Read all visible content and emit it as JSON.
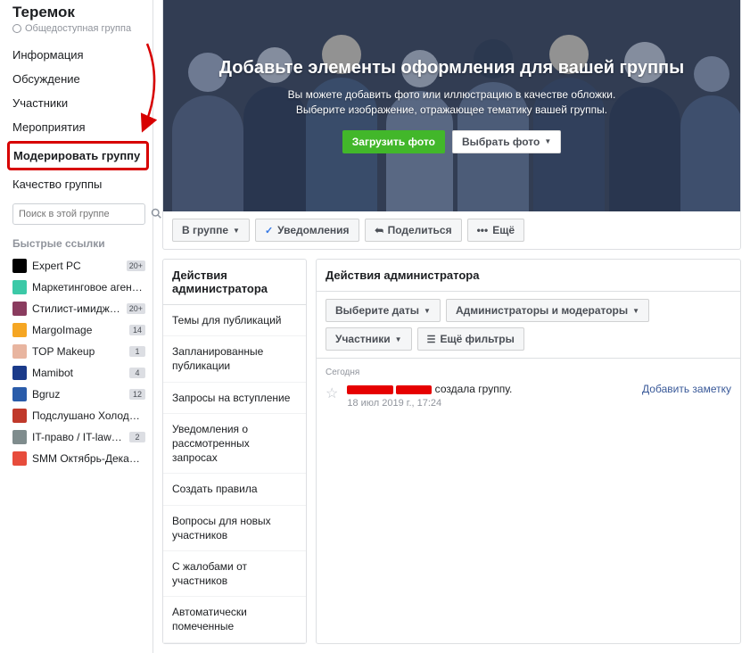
{
  "sidebar": {
    "group_name": "Теремок",
    "group_visibility": "Общедоступная группа",
    "nav": [
      {
        "label": "Информация"
      },
      {
        "label": "Обсуждение"
      },
      {
        "label": "Участники"
      },
      {
        "label": "Мероприятия"
      },
      {
        "label": "Модерировать группу",
        "highlighted": true
      },
      {
        "label": "Качество группы"
      }
    ],
    "search_placeholder": "Поиск в этой группе",
    "quick_links_title": "Быстрые ссылки",
    "quick_links": [
      {
        "label": "Expert PC",
        "badge": "20+",
        "color": "#000000"
      },
      {
        "label": "Маркетинговое агентс...",
        "badge": "",
        "color": "#3cc9a7"
      },
      {
        "label": "Стилист-имиджме...",
        "badge": "20+",
        "color": "#8a3c5f"
      },
      {
        "label": "MargoImage",
        "badge": "14",
        "color": "#f5a623"
      },
      {
        "label": "TOP Makeup",
        "badge": "1",
        "color": "#e8b5a0"
      },
      {
        "label": "Mamibot",
        "badge": "4",
        "color": "#1a3a8a"
      },
      {
        "label": "Bgruz",
        "badge": "12",
        "color": "#2a5caa"
      },
      {
        "label": "Подслушано Холодна...",
        "badge": "",
        "color": "#c0392b"
      },
      {
        "label": "IT-право / IT-law и д...",
        "badge": "2",
        "color": "#7f8c8d"
      },
      {
        "label": "SMM Октябрь-Декабрь",
        "badge": "",
        "color": "#e74c3c"
      }
    ]
  },
  "cover": {
    "title": "Добавьте элементы оформления для вашей группы",
    "line1": "Вы можете добавить фото или иллюстрацию в качестве обложки.",
    "line2": "Выберите изображение, отражающее тематику вашей группы.",
    "upload_label": "Загрузить фото",
    "choose_label": "Выбрать фото"
  },
  "actionbar": {
    "in_group": "В группе",
    "notifications": "Уведомления",
    "share": "Поделиться",
    "more": "Ещё"
  },
  "admin_panel": {
    "title": "Действия администратора",
    "items": [
      "Темы для публикаций",
      "Запланированные публикации",
      "Запросы на вступление",
      "Уведомления о рассмотренных запросах",
      "Создать правила",
      "Вопросы для новых участников",
      "С жалобами от участников",
      "Автоматически помеченные"
    ]
  },
  "right_panel": {
    "title": "Действия администратора",
    "filters": {
      "dates": "Выберите даты",
      "admins": "Администраторы и модераторы",
      "members": "Участники",
      "more": "Ещё фильтры"
    },
    "day_label": "Сегодня",
    "entry_text": " создала группу.",
    "entry_time": "18 июл 2019 г., 17:24",
    "add_note": "Добавить заметку"
  }
}
